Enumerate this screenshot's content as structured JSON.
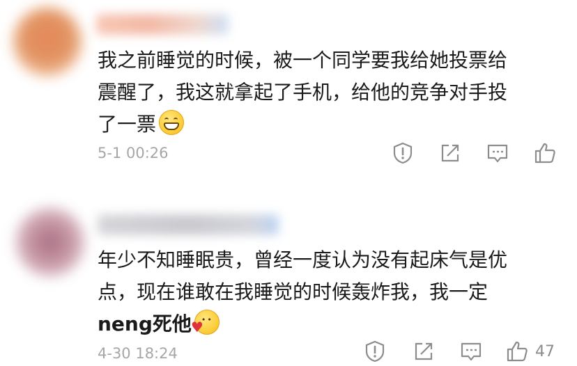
{
  "comments": [
    {
      "text_lines": [
        "我之前睡觉的时候，被一个同学要我给她投票给",
        "震醒了，我这就拿起了手机，给他的竞争对手投",
        "了一票"
      ],
      "emoji": "grinning-face-icon",
      "timestamp": "5-1 00:26",
      "like_count": ""
    },
    {
      "text_lines": [
        "年少不知睡眠贵，曾经一度认为没有起床气是优",
        "点，现在谁敢在我睡觉的时候轰炸我，我一定",
        "neng死他"
      ],
      "emoji": "face-with-heart-icon",
      "timestamp": "4-30 18:24",
      "like_count": "47"
    }
  ],
  "colors": {
    "text": "#1a1a1a",
    "meta": "#a6a6a6",
    "icon": "#8c8c8c"
  }
}
